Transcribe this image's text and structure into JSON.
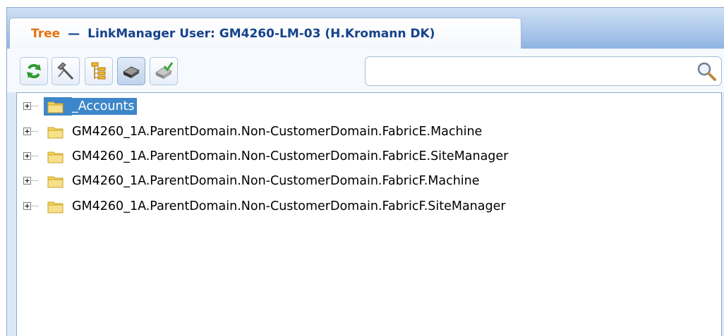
{
  "tab": {
    "title": "Tree",
    "separator": "—",
    "subtitle": "LinkManager User: GM4260-LM-03 (H.Kromann DK)"
  },
  "toolbar": {
    "buttons": [
      {
        "icon": "refresh-icon"
      },
      {
        "icon": "tools-icon"
      },
      {
        "icon": "tree-structure-icon"
      },
      {
        "icon": "device-icon",
        "active": true
      },
      {
        "icon": "device-check-icon"
      }
    ]
  },
  "search": {
    "value": "",
    "placeholder": "",
    "icon": "magnifier-icon"
  },
  "tree": {
    "nodes": [
      {
        "label": "_Accounts",
        "selected": true
      },
      {
        "label": "GM4260_1A.ParentDomain.Non-CustomerDomain.FabricE.Machine"
      },
      {
        "label": "GM4260_1A.ParentDomain.Non-CustomerDomain.FabricE.SiteManager"
      },
      {
        "label": "GM4260_1A.ParentDomain.Non-CustomerDomain.FabricF.Machine"
      },
      {
        "label": "GM4260_1A.ParentDomain.Non-CustomerDomain.FabricF.SiteManager"
      }
    ]
  },
  "colors": {
    "tab_title": "#e8720c",
    "tab_text": "#15428b",
    "selection": "#3d86c9",
    "folder": "#f3d45c"
  }
}
